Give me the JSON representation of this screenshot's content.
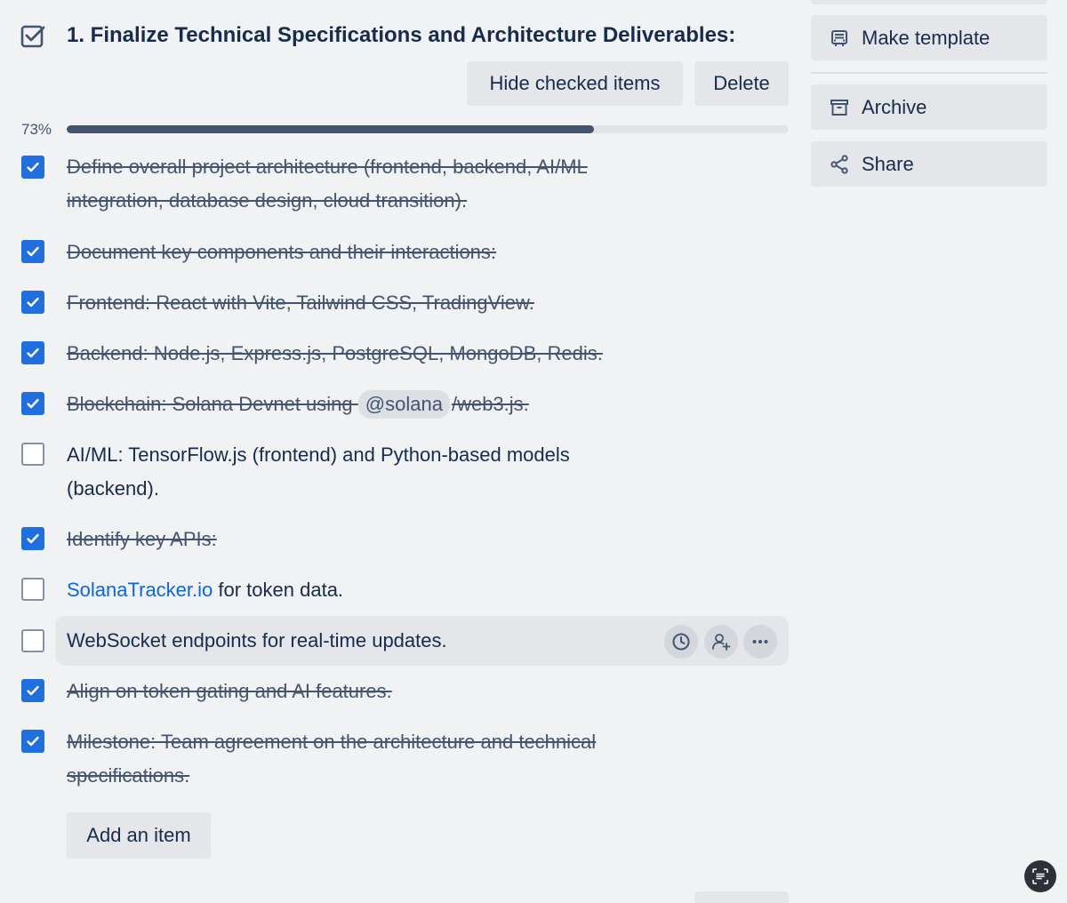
{
  "checklist": {
    "title": "1. Finalize Technical Specifications and Architecture Deliverables:",
    "hide_checked_label": "Hide checked items",
    "delete_label": "Delete",
    "progress_text": "73%",
    "progress_value": 73,
    "items": [
      {
        "checked": true,
        "text": "Define overall project architecture (frontend, backend, AI/ML integration, database design, cloud transition)."
      },
      {
        "checked": true,
        "text": "Document key components and their interactions:"
      },
      {
        "checked": true,
        "text": "Frontend: React with Vite, Tailwind CSS, TradingView."
      },
      {
        "checked": true,
        "text": "Backend: Node.js, Express.js, PostgreSQL, MongoDB, Redis."
      },
      {
        "checked": true,
        "text_before": "Blockchain: Solana Devnet using",
        "mention": "@solana",
        "text_after": "/web3.js."
      },
      {
        "checked": false,
        "text": "AI/ML: TensorFlow.js (frontend) and Python-based models (backend)."
      },
      {
        "checked": true,
        "text": "Identify key APIs:"
      },
      {
        "checked": false,
        "link": "SolanaTracker.io",
        "text_after": " for token data."
      },
      {
        "checked": false,
        "text": "WebSocket endpoints for real-time updates."
      },
      {
        "checked": true,
        "text": "Align on token gating and AI features."
      },
      {
        "checked": true,
        "text": "Milestone: Team agreement on the architecture and technical specifications."
      }
    ],
    "add_item_label": "Add an item"
  },
  "sidebar": {
    "make_template_label": "Make template",
    "archive_label": "Archive",
    "share_label": "Share"
  },
  "colors": {
    "accent": "#1f6fe0",
    "link": "#0c66e4",
    "text": "#172b4d",
    "background": "#f1f2f4",
    "button_bg": "#e4e6ea"
  },
  "icons": {
    "header": "checklist-icon",
    "make_template": "template-card-icon",
    "archive": "archive-box-icon",
    "share": "share-nodes-icon",
    "due_date": "clock-icon",
    "assign": "add-member-icon",
    "more": "ellipsis-icon",
    "floating": "scan-text-icon"
  }
}
